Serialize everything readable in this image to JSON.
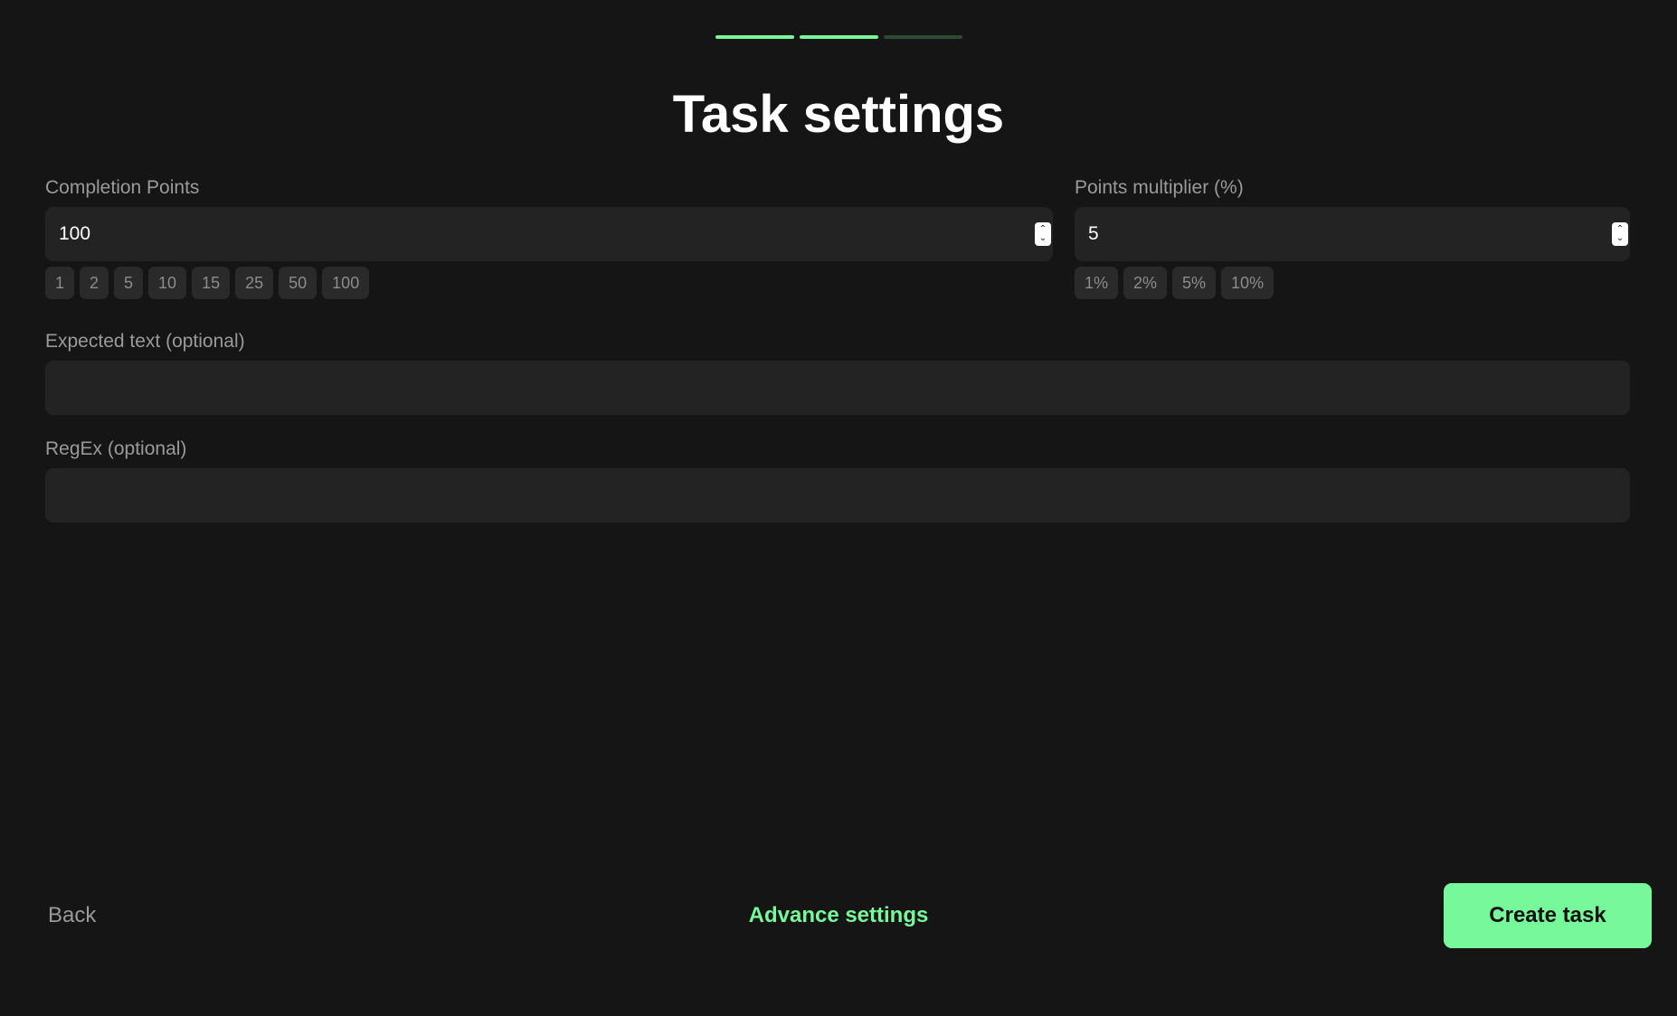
{
  "progress": {
    "steps_total": 3,
    "steps_completed": 2
  },
  "colors": {
    "accent": "#77f89a",
    "background": "#151515",
    "field": "#232323"
  },
  "page": {
    "title": "Task settings"
  },
  "completion_points": {
    "label": "Completion Points",
    "value": "100",
    "presets": [
      "1",
      "2",
      "5",
      "10",
      "15",
      "25",
      "50",
      "100"
    ]
  },
  "points_multiplier": {
    "label": "Points multiplier (%)",
    "value": "5",
    "presets": [
      "1%",
      "2%",
      "5%",
      "10%"
    ]
  },
  "expected_text": {
    "label": "Expected text (optional)",
    "value": ""
  },
  "regex": {
    "label": "RegEx (optional)",
    "value": ""
  },
  "footer": {
    "back_label": "Back",
    "advance_label": "Advance settings",
    "create_label": "Create task"
  }
}
